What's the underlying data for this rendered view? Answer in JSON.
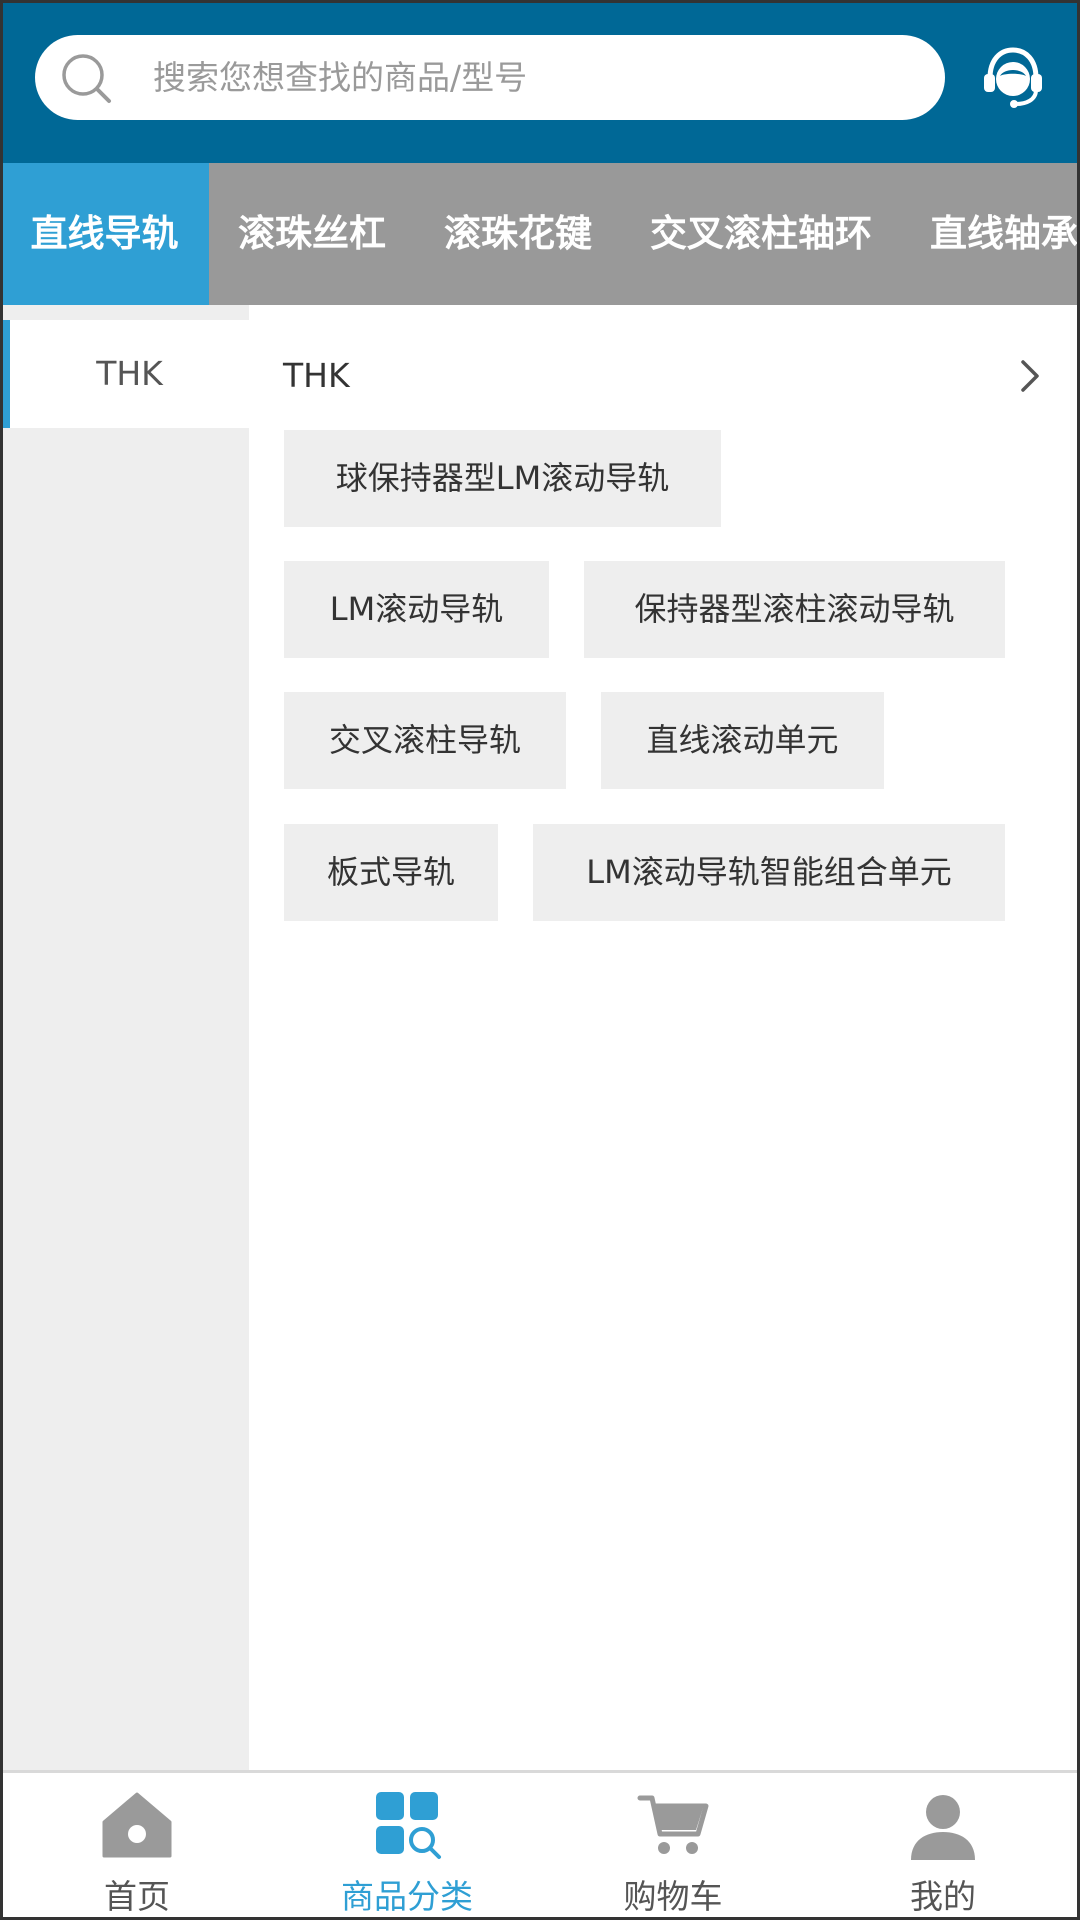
{
  "header": {
    "search_placeholder": "搜索您想查找的商品/型号"
  },
  "category_tabs": [
    {
      "label": "直线导轨",
      "active": true
    },
    {
      "label": "滚珠丝杠",
      "active": false
    },
    {
      "label": "滚珠花键",
      "active": false
    },
    {
      "label": "交叉滚柱轴环",
      "active": false
    },
    {
      "label": "直线轴承",
      "active": false
    }
  ],
  "brands": [
    {
      "label": "THK",
      "active": true
    }
  ],
  "content": {
    "brand_title": "THK",
    "products": [
      "球保持器型LM滚动导轨",
      "LM滚动导轨",
      "保持器型滚柱滚动导轨",
      "交叉滚柱导轨",
      "直线滚动单元",
      "板式导轨",
      "LM滚动导轨智能组合单元"
    ]
  },
  "bottom_nav": [
    {
      "label": "首页",
      "icon": "home-icon",
      "active": false
    },
    {
      "label": "商品分类",
      "icon": "category-search-icon",
      "active": true
    },
    {
      "label": "购物车",
      "icon": "cart-icon",
      "active": false
    },
    {
      "label": "我的",
      "icon": "user-icon",
      "active": false
    }
  ],
  "colors": {
    "header_bg": "#006896",
    "accent": "#2f9fd4",
    "tab_bar_bg": "#999999",
    "tag_bg": "#eeeeee",
    "nav_icon_gray": "#9a9a9a"
  }
}
